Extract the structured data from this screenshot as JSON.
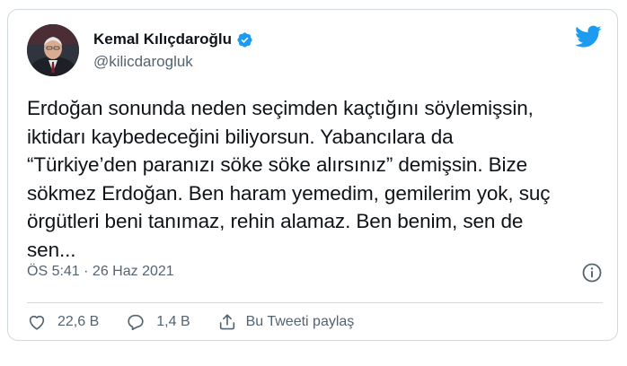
{
  "author": {
    "name": "Kemal Kılıçdaroğlu",
    "handle": "@kilicdarogluk"
  },
  "tweet": {
    "text": "Erdoğan sonunda neden seçimden kaçtığını söylemişsin,\niktidarı kaybedeceğini biliyorsun. Yabancılara da\n“Türkiye’den paranızı söke söke alırsınız” demişsin. Bize\nsökmez Erdoğan. Ben haram yemedim, gemilerim yok, suç\nörgütleri beni tanımaz, rehin alamaz. Ben benim, sen de\nsen...",
    "timestamp": "ÖS 5:41 · 26 Haz 2021"
  },
  "actions": {
    "likes": "22,6 B",
    "replies": "1,4 B",
    "share_label": "Bu Tweeti paylaş"
  },
  "icons": {
    "verified": "verified-badge-icon",
    "brand": "twitter-bird-icon",
    "info": "info-icon",
    "like": "heart-icon",
    "reply": "reply-bubble-icon",
    "share": "share-icon"
  },
  "colors": {
    "brand": "#1d9bf0",
    "text": "#0f1419",
    "secondary": "#536471",
    "border": "#cfd9de"
  }
}
